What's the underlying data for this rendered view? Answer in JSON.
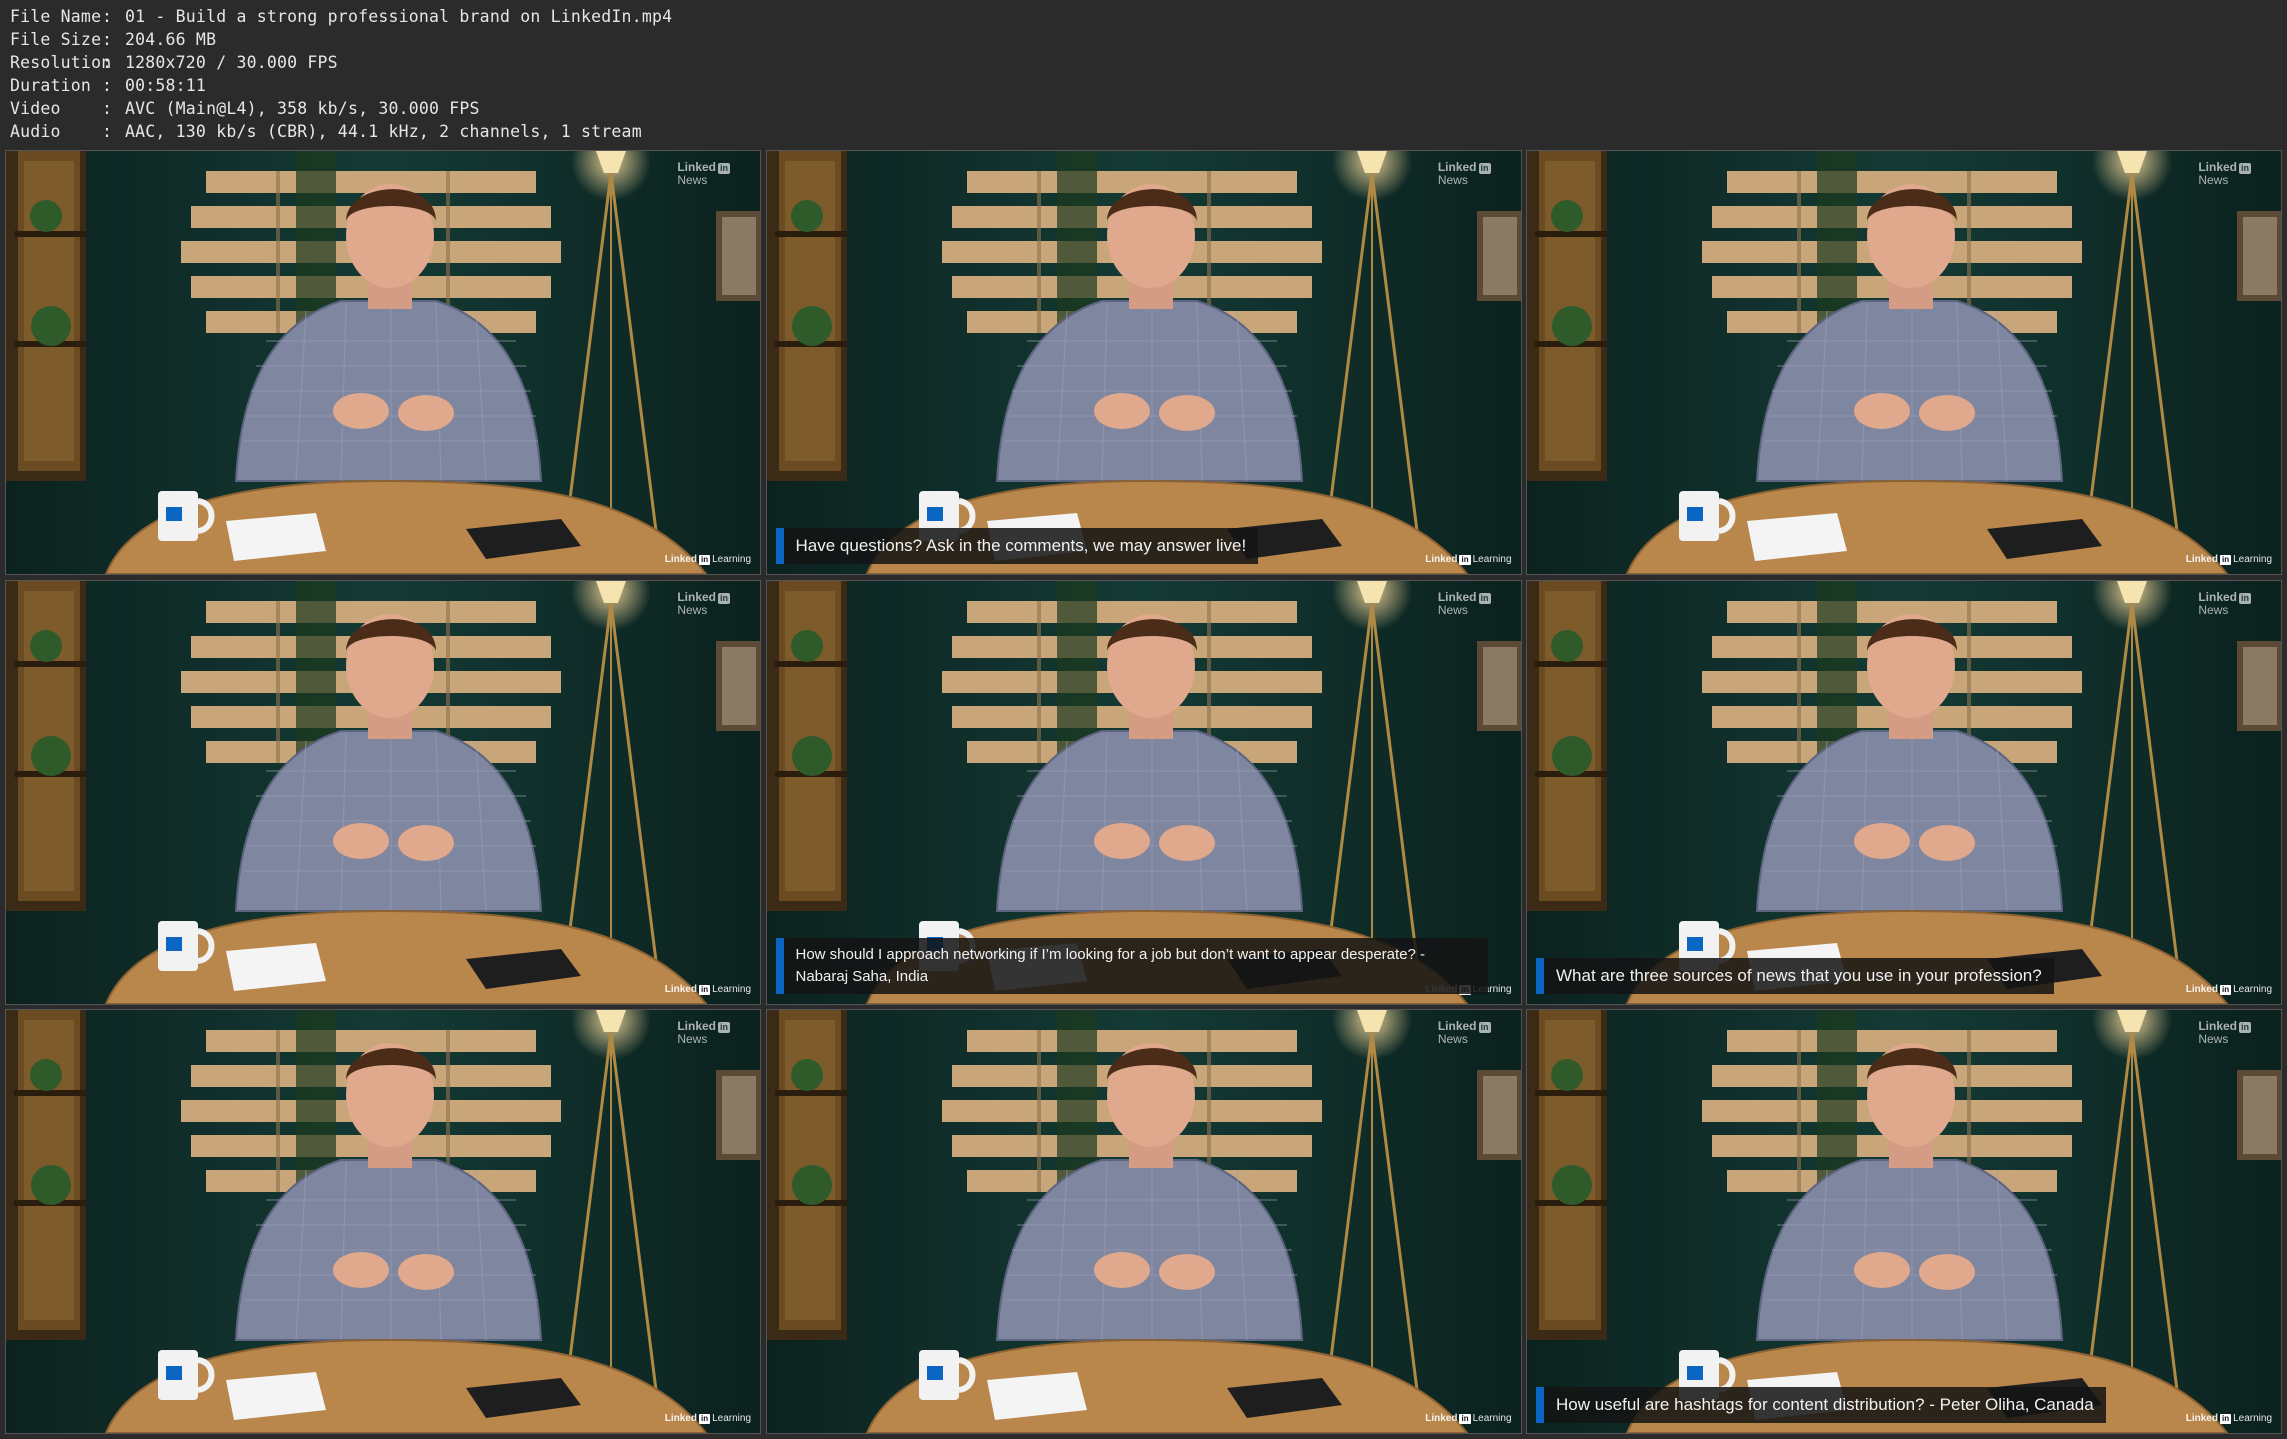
{
  "info": {
    "rows": [
      {
        "label": "File Name",
        "value": "01 - Build a strong professional brand on LinkedIn.mp4"
      },
      {
        "label": "File Size",
        "value": "204.66 MB"
      },
      {
        "label": "Resolution",
        "value": "1280x720 / 30.000 FPS"
      },
      {
        "label": "Duration",
        "value": "00:58:11"
      },
      {
        "label": "Video",
        "value": "AVC (Main@L4), 358 kb/s, 30.000 FPS"
      },
      {
        "label": "Audio",
        "value": "AAC, 130 kb/s (CBR), 44.1 kHz, 2 channels, 1 stream"
      }
    ],
    "separator": ":"
  },
  "branding": {
    "news_top": "Linked",
    "news_in": "in",
    "news_bottom": "News",
    "learning_left": "Linked",
    "learning_in": "in",
    "learning_right": "Learning"
  },
  "thumbnails": [
    {
      "caption": ""
    },
    {
      "caption": "Have questions? Ask in the comments, we may answer live!"
    },
    {
      "caption": ""
    },
    {
      "caption": ""
    },
    {
      "caption": "How should I approach networking if I’m looking for a job but don’t want to appear desperate? - Nabaraj Saha, India"
    },
    {
      "caption": "What are three sources of news that you use in your profession?"
    },
    {
      "caption": ""
    },
    {
      "caption": ""
    },
    {
      "caption": "How useful are hashtags for content distribution? - Peter Oliha, Canada"
    }
  ],
  "colors": {
    "background": "#2b2b2b",
    "wall": "#0f2a26",
    "caption_accent": "#0a66c2",
    "desk": "#b9864c",
    "shirt": "#7f86a0"
  }
}
